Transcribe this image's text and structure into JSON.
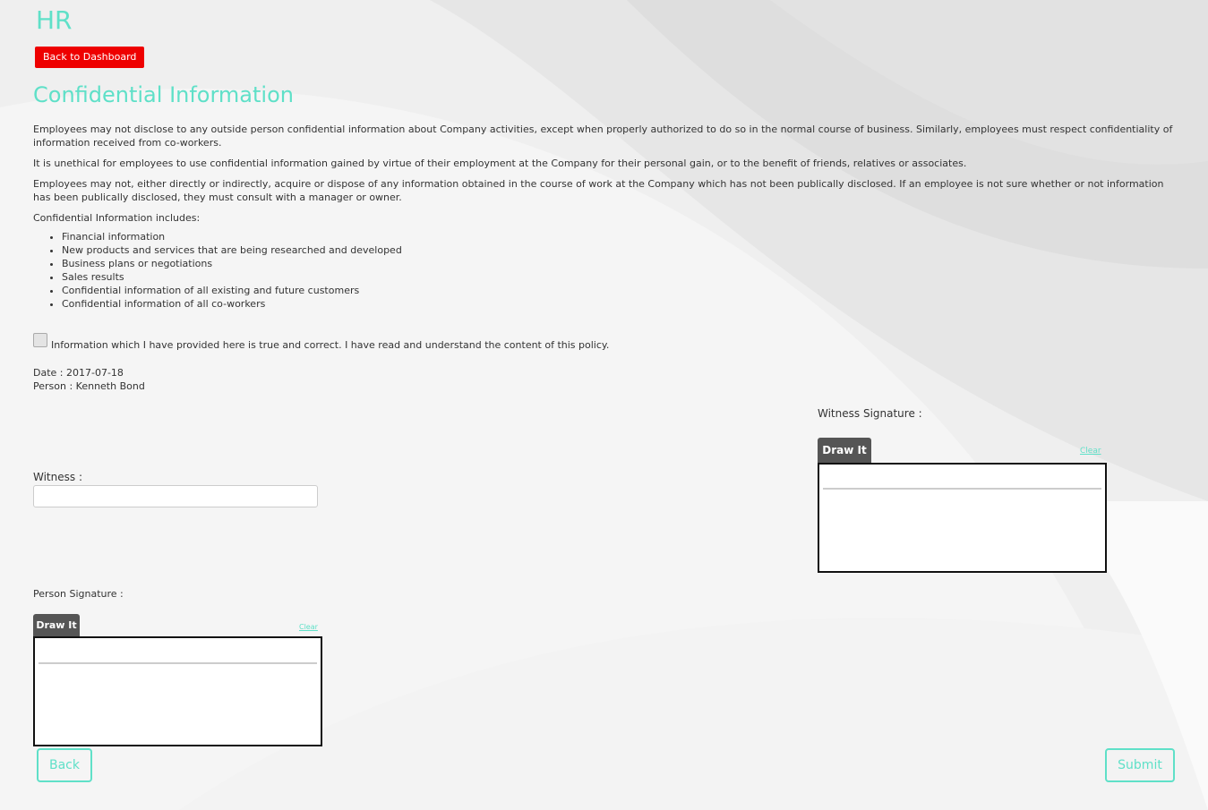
{
  "header": {
    "app_title": "HR",
    "back_dashboard_label": "Back to Dashboard"
  },
  "policy": {
    "title": "Confidential Information",
    "paragraphs": [
      "Employees may not disclose to any outside person confidential information about Company activities, except when properly authorized to do so in the normal course of business. Similarly, employees must respect confidentiality of information received from co-workers.",
      "It is unethical for employees to use confidential information gained by virtue of their employment at the Company for their personal gain, or to the benefit of friends, relatives or associates.",
      "Employees may not, either directly or indirectly, acquire or dispose of any information obtained in the course of work at the Company which has not been publically disclosed. If an employee is not sure whether or not information has been publically disclosed, they must consult with a manager or owner."
    ],
    "list_intro": "Confidential Information includes:",
    "items": [
      "Financial information",
      "New products and services that are being researched and developed",
      "Business plans or negotiations",
      "Sales results",
      "Confidential information of all existing and future customers",
      "Confidential information of all co-workers"
    ]
  },
  "agreement": {
    "checked": false,
    "label": "Information which I have provided here is true and correct. I have read and understand the content of this policy."
  },
  "meta": {
    "date_line": "Date : 2017-07-18",
    "person_line": "Person : Kenneth Bond"
  },
  "witness": {
    "label": "Witness :",
    "value": "",
    "placeholder": ""
  },
  "witness_signature": {
    "label": "Witness Signature :",
    "tab_label": "Draw It",
    "clear_label": "Clear"
  },
  "person_signature": {
    "label": "Person Signature :",
    "tab_label": "Draw It",
    "clear_label": "Clear"
  },
  "footer": {
    "back_label": "Back",
    "submit_label": "Submit"
  },
  "colors": {
    "accent": "#5fe0c8",
    "danger": "#ee0000",
    "tab": "#555555",
    "background": "#f1f1f1"
  }
}
